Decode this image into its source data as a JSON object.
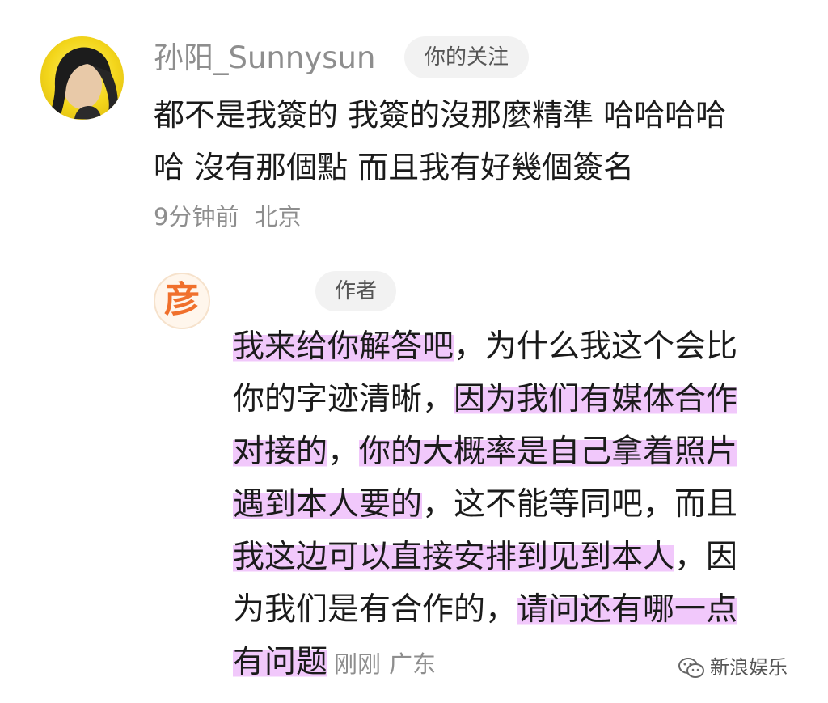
{
  "comment": {
    "username": "孙阳_Sunnysun",
    "follow_badge": "你的关注",
    "lines": [
      "都不是我簽的 我簽的沒那麼精準 哈哈哈哈",
      "哈 沒有那個點 而且我有好幾個簽名"
    ],
    "time": "9分钟前",
    "location": "北京"
  },
  "reply": {
    "avatar_char": "彦",
    "author_badge": "作者",
    "segments": [
      "我来给你解答吧",
      "，为什么我这个会比",
      "你的字迹清晰，",
      "因为我们有媒体合作",
      "对接的",
      "，",
      "你的大概率是自己拿着照片",
      "遇到本人要的",
      "，这不能等同吧，而且",
      "我这边可以直接安排到见到本人",
      "，因",
      "为我们是有合作的，",
      "请问还有哪一点",
      "有问题"
    ],
    "time": "刚刚",
    "location": "广东"
  },
  "watermark": {
    "icon": "wechat-icon",
    "text": "新浪娱乐"
  },
  "colors": {
    "highlight": "#f1c8fb",
    "secondary_text": "#8e8e8e",
    "avatar_reply": "#f0702c"
  }
}
